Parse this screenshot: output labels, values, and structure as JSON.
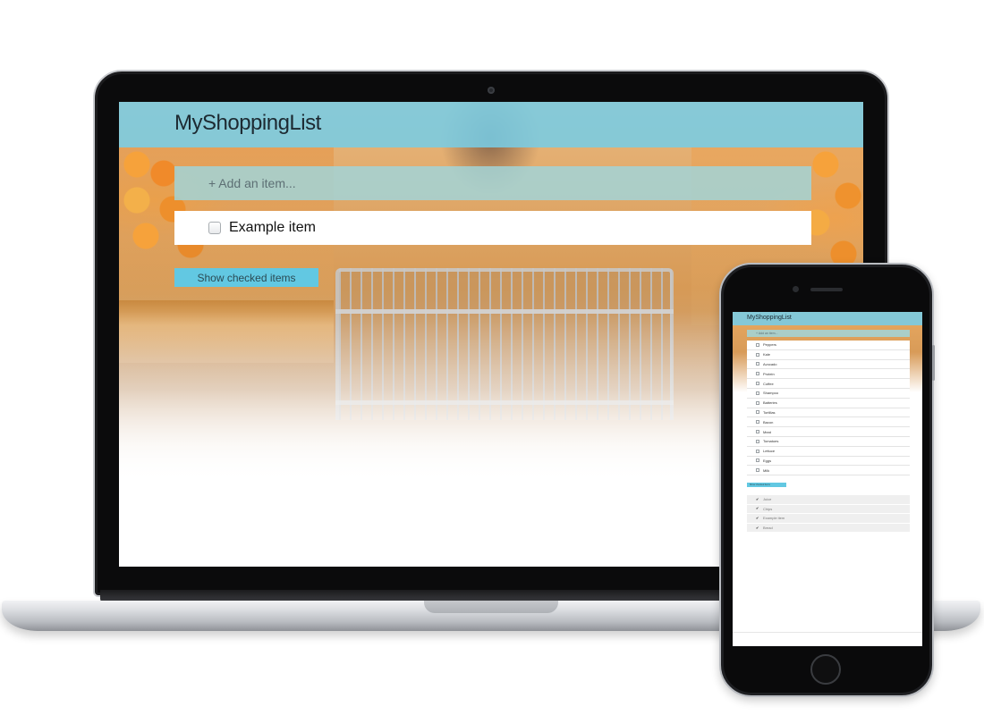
{
  "laptop": {
    "app_title": "MyShoppingList",
    "add_placeholder": "+ Add an item...",
    "items": [
      {
        "label": "Example item",
        "checked": false
      }
    ],
    "show_checked_label": "Show checked items"
  },
  "phone": {
    "app_title": "MyShoppingList",
    "add_placeholder": "+ Add an item...",
    "items": [
      {
        "label": "Peppers"
      },
      {
        "label": "Kale"
      },
      {
        "label": "Avocado"
      },
      {
        "label": "Protein"
      },
      {
        "label": "Coffee"
      },
      {
        "label": "Shampoo"
      },
      {
        "label": "Batteries"
      },
      {
        "label": "Tortillas"
      },
      {
        "label": "Bacon"
      },
      {
        "label": "Meat"
      },
      {
        "label": "Tomatoes"
      },
      {
        "label": "Lettuce"
      },
      {
        "label": "Eggs"
      },
      {
        "label": "Milk"
      }
    ],
    "show_checked_label": "Show checked items",
    "checked_items": [
      {
        "label": "Juice"
      },
      {
        "label": "Chips"
      },
      {
        "label": "Example item"
      },
      {
        "label": "Bread"
      }
    ]
  },
  "colors": {
    "header": "#79cce4",
    "input": "#a0d6dc",
    "button": "#62c8e2"
  },
  "icons": {
    "unchecked": "checkbox-icon",
    "checked": "checkmark-icon"
  }
}
